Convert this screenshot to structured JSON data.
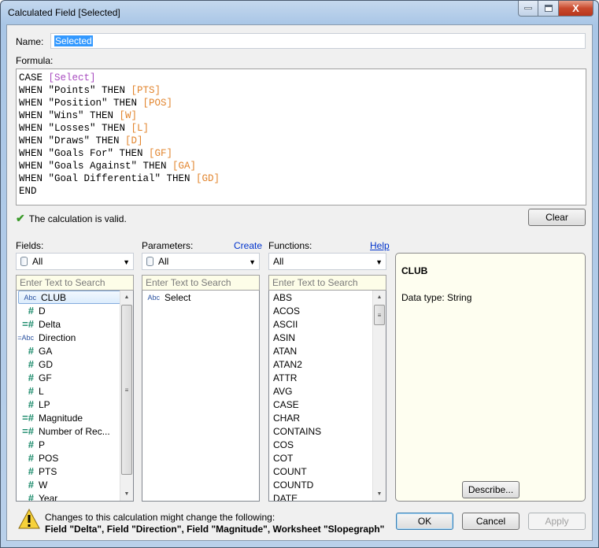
{
  "window": {
    "title": "Calculated Field [Selected]",
    "controls": {
      "minimize": "minimize",
      "maximize": "maximize",
      "close": "X"
    }
  },
  "name": {
    "label": "Name:",
    "value": "Selected"
  },
  "formula": {
    "label": "Formula:",
    "lines": [
      [
        {
          "t": "CASE ",
          "c": "kw"
        },
        {
          "t": "[Select]",
          "c": "param"
        }
      ],
      [
        {
          "t": "WHEN \"Points\" THEN ",
          "c": "kw"
        },
        {
          "t": "[PTS]",
          "c": "field"
        }
      ],
      [
        {
          "t": "WHEN \"Position\" THEN ",
          "c": "kw"
        },
        {
          "t": "[POS]",
          "c": "field"
        }
      ],
      [
        {
          "t": "WHEN \"Wins\" THEN ",
          "c": "kw"
        },
        {
          "t": "[W]",
          "c": "field"
        }
      ],
      [
        {
          "t": "WHEN \"Losses\" THEN ",
          "c": "kw"
        },
        {
          "t": "[L]",
          "c": "field"
        }
      ],
      [
        {
          "t": "WHEN \"Draws\" THEN ",
          "c": "kw"
        },
        {
          "t": "[D]",
          "c": "field"
        }
      ],
      [
        {
          "t": "WHEN \"Goals For\" THEN ",
          "c": "kw"
        },
        {
          "t": "[GF]",
          "c": "field"
        }
      ],
      [
        {
          "t": "WHEN \"Goals Against\" THEN ",
          "c": "kw"
        },
        {
          "t": "[GA]",
          "c": "field"
        }
      ],
      [
        {
          "t": "WHEN \"Goal Differential\" THEN ",
          "c": "kw"
        },
        {
          "t": "[GD]",
          "c": "field"
        }
      ],
      [
        {
          "t": "END",
          "c": "kw"
        }
      ]
    ],
    "colors": {
      "field": "#e2852e",
      "param": "#a84cc0"
    }
  },
  "status": {
    "icon": "checkmark-icon",
    "text": "The calculation is valid."
  },
  "buttons": {
    "clear": "Clear",
    "describe": "Describe...",
    "ok": "OK",
    "cancel": "Cancel",
    "apply": "Apply"
  },
  "fields": {
    "label": "Fields:",
    "combo": "All",
    "search_placeholder": "Enter Text to Search",
    "items": [
      {
        "icon": "Abc",
        "name": "CLUB",
        "selected": true
      },
      {
        "icon": "#",
        "name": "D"
      },
      {
        "icon": "=#",
        "name": "Delta"
      },
      {
        "icon": "=Abc",
        "name": "Direction"
      },
      {
        "icon": "#",
        "name": "GA"
      },
      {
        "icon": "#",
        "name": "GD"
      },
      {
        "icon": "#",
        "name": "GF"
      },
      {
        "icon": "#",
        "name": "L"
      },
      {
        "icon": "#",
        "name": "LP"
      },
      {
        "icon": "=#",
        "name": "Magnitude"
      },
      {
        "icon": "=#",
        "name": "Number of Rec..."
      },
      {
        "icon": "#",
        "name": "P"
      },
      {
        "icon": "#",
        "name": "POS"
      },
      {
        "icon": "#",
        "name": "PTS"
      },
      {
        "icon": "#",
        "name": "W"
      },
      {
        "icon": "#",
        "name": "Year"
      }
    ]
  },
  "parameters": {
    "label": "Parameters:",
    "create_link": "Create",
    "combo": "All",
    "search_placeholder": "Enter Text to Search",
    "items": [
      {
        "icon": "Abc",
        "name": "Select"
      }
    ]
  },
  "functions": {
    "label": "Functions:",
    "help_link": "Help",
    "combo": "All",
    "search_placeholder": "Enter Text to Search",
    "items": [
      "ABS",
      "ACOS",
      "ASCII",
      "ASIN",
      "ATAN",
      "ATAN2",
      "ATTR",
      "AVG",
      "CASE",
      "CHAR",
      "CONTAINS",
      "COS",
      "COT",
      "COUNT",
      "COUNTD",
      "DATE"
    ]
  },
  "info_panel": {
    "title": "CLUB",
    "description": "Data type: String"
  },
  "warning": {
    "line1": "Changes to this calculation might change the following:",
    "line2": "Field \"Delta\", Field \"Direction\", Field \"Magnitude\", Worksheet \"Slopegraph\""
  }
}
